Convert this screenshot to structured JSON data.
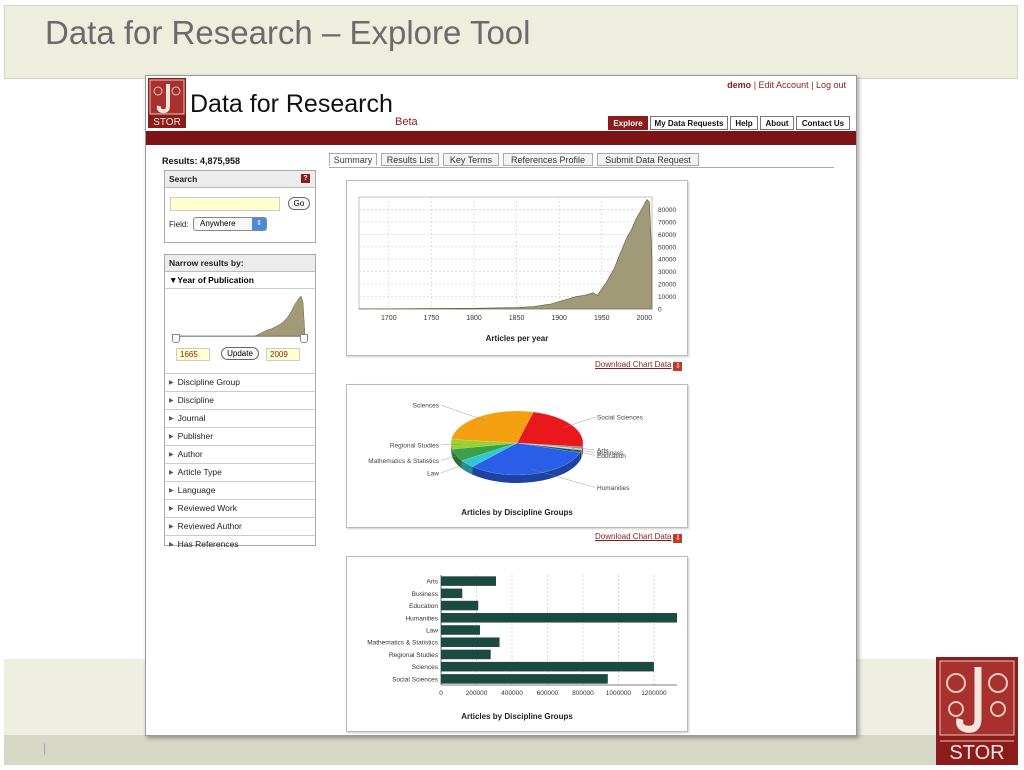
{
  "slide": {
    "title": "Data for Research – Explore Tool",
    "footer_mark": "|",
    "logo_text": "STOR"
  },
  "site": {
    "title": "Data for Research",
    "beta": "Beta",
    "logo_text": "STOR",
    "user": {
      "name": "demo",
      "edit_account": "Edit Account",
      "logout": "Log out",
      "sep": "|"
    },
    "nav": [
      "Explore",
      "My Data Requests",
      "Help",
      "About",
      "Contact Us"
    ],
    "active_nav": "Explore",
    "accent_color": "#8c1c1c"
  },
  "results": {
    "label": "Results: 4,875,958"
  },
  "tabs": [
    "Summary",
    "Results List",
    "Key Terms",
    "References Profile",
    "Submit Data Request"
  ],
  "search": {
    "title": "Search",
    "help": "?",
    "input_value": "",
    "go_label": "Go",
    "field_label": "Field:",
    "field_value": "Anywhere"
  },
  "narrow": {
    "title": "Narrow results by:",
    "year_section": "Year of Publication",
    "year_from": "1665",
    "year_to": "2009",
    "update_label": "Update",
    "facets": [
      "Discipline Group",
      "Discipline",
      "Journal",
      "Publisher",
      "Author",
      "Article Type",
      "Language",
      "Reviewed Work",
      "Reviewed Author",
      "Has References"
    ]
  },
  "download_label": "Download Chart Data",
  "chart_data": [
    {
      "type": "area",
      "title": "Articles per year",
      "color": "#a09a78",
      "xticks": [
        "1700",
        "1750",
        "1800",
        "1850",
        "1900",
        "1950",
        "2000"
      ],
      "yticks": [
        "0",
        "10000",
        "20000",
        "30000",
        "40000",
        "50000",
        "60000",
        "70000",
        "80000"
      ],
      "xlim": [
        1665,
        2009
      ],
      "ylim": [
        0,
        90000
      ],
      "x": [
        1665,
        1700,
        1750,
        1800,
        1850,
        1870,
        1880,
        1890,
        1900,
        1910,
        1920,
        1930,
        1940,
        1945,
        1950,
        1955,
        1960,
        1965,
        1970,
        1975,
        1980,
        1985,
        1990,
        1995,
        2000,
        2003,
        2006,
        2009
      ],
      "y": [
        100,
        200,
        300,
        600,
        1200,
        2000,
        3000,
        4000,
        6000,
        8000,
        10000,
        11000,
        13000,
        11000,
        16000,
        21000,
        27000,
        33000,
        42000,
        50000,
        58000,
        64000,
        72000,
        78000,
        84000,
        88000,
        86000,
        40000
      ]
    },
    {
      "type": "pie",
      "title": "Articles by Discipline Groups",
      "slices": [
        {
          "label": "Social Sciences",
          "value": 930000,
          "color": "#e8181c"
        },
        {
          "label": "Arts",
          "value": 40000,
          "color": "#9a9a9a"
        },
        {
          "label": "Business",
          "value": 30000,
          "color": "#d0d0d0"
        },
        {
          "label": "Education",
          "value": 50000,
          "color": "#145a4a"
        },
        {
          "label": "Humanities",
          "value": 1290000,
          "color": "#2a5ee8"
        },
        {
          "label": "Law",
          "value": 160000,
          "color": "#30c8d8"
        },
        {
          "label": "Mathematics & Statistics",
          "value": 250000,
          "color": "#3aa04a"
        },
        {
          "label": "Regional Studies",
          "value": 200000,
          "color": "#9ad030"
        },
        {
          "label": "Sciences",
          "value": 1100000,
          "color": "#f4a010"
        }
      ]
    },
    {
      "type": "bar",
      "title": "Articles by Discipline Groups",
      "color": "#1d4a40",
      "categories": [
        "Arts",
        "Business",
        "Education",
        "Humanities",
        "Law",
        "Mathematics & Statistics",
        "Regional Studies",
        "Sciences",
        "Social Sciences"
      ],
      "values": [
        310000,
        120000,
        210000,
        1330000,
        220000,
        330000,
        280000,
        1200000,
        940000
      ],
      "xticks": [
        "0",
        "200000",
        "400000",
        "600000",
        "800000",
        "1000000",
        "1200000"
      ],
      "xlim": [
        0,
        1330000
      ]
    }
  ]
}
